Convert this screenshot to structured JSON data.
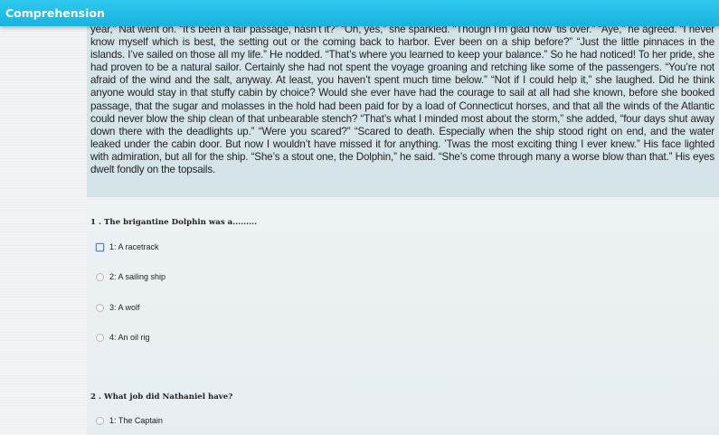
{
  "header": {
    "title": "Comprehension"
  },
  "passage": {
    "text": "year,” Nat went on. “It’s been a fair passage, hasn’t it?” “Oh, yes,” she sparkled. “Though I’m glad now ’tis over.” “Aye,” he agreed. “I never know myself which is best, the setting out or the coming back to harbor. Ever been on a ship before?” “Just the little pinnaces in the islands. I’ve sailed on those all my life.” He nodded. “That’s where you learned to keep your balance.” So he had noticed! To her pride, she had proven to be a natural sailor. Certainly she had not spent the voyage groaning and retching like some of the passengers. “You’re not afraid of the wind and the salt, anyway. At least, you haven’t spent much time below.” “Not if I could help it,” she laughed. Did he think anyone would stay in that stuffy cabin by choice? Would she ever have had the courage to sail at all had she known, before she booked passage, that the sugar and molasses in the hold had been paid for by a load of Connecticut horses, and that all the winds of the Atlantic could never blow the ship clean of that unbearable stench? “That’s what I minded most about the storm,” she added, “four days shut away down there with the deadlights up.” “Were you scared?” “Scared to death. Especially when the ship stood right on end, and the water leaked under the cabin door. But now I wouldn’t have missed it for anything. ’Twas the most exciting thing I ever knew.” His face lighted with admiration, but all for the ship. “She’s a stout one, the Dolphin,” he said. “She’s come through many a worse blow than that.” His eyes dwelt fondly on the topsails."
  },
  "questions": [
    {
      "number": "1 .",
      "text": "The brigantine Dolphin was a.........",
      "options": [
        {
          "label": "1: A racetrack"
        },
        {
          "label": "2: A sailing ship"
        },
        {
          "label": "3: A wolf"
        },
        {
          "label": "4: An oil rig"
        }
      ]
    },
    {
      "number": "2 .",
      "text": "What job did Nathaniel have?",
      "options": [
        {
          "label": "1: The Captain"
        }
      ]
    }
  ]
}
